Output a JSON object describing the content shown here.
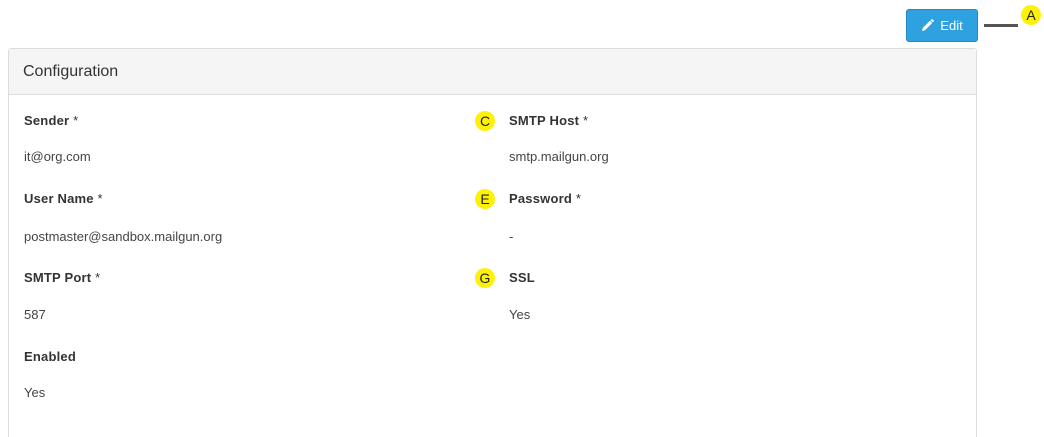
{
  "toolbar": {
    "edit_label": "Edit",
    "edit_icon": "pencil-icon",
    "accent_color": "#2ea1e0"
  },
  "markers": {
    "a": "A",
    "c": "C",
    "e": "E",
    "g": "G",
    "color": "#fdf10a"
  },
  "panel": {
    "title": "Configuration",
    "fields": {
      "sender": {
        "label": "Sender",
        "required": "*",
        "value": "it@org.com"
      },
      "smtp_host": {
        "label": "SMTP Host",
        "required": "*",
        "value": "smtp.mailgun.org"
      },
      "user_name": {
        "label": "User Name",
        "required": "*",
        "value": "postmaster@sandbox.mailgun.org"
      },
      "password": {
        "label": "Password",
        "required": "*",
        "value": "-"
      },
      "smtp_port": {
        "label": "SMTP Port",
        "required": "*",
        "value": "587"
      },
      "ssl": {
        "label": "SSL",
        "value": "Yes"
      },
      "enabled": {
        "label": "Enabled",
        "value": "Yes"
      }
    }
  }
}
